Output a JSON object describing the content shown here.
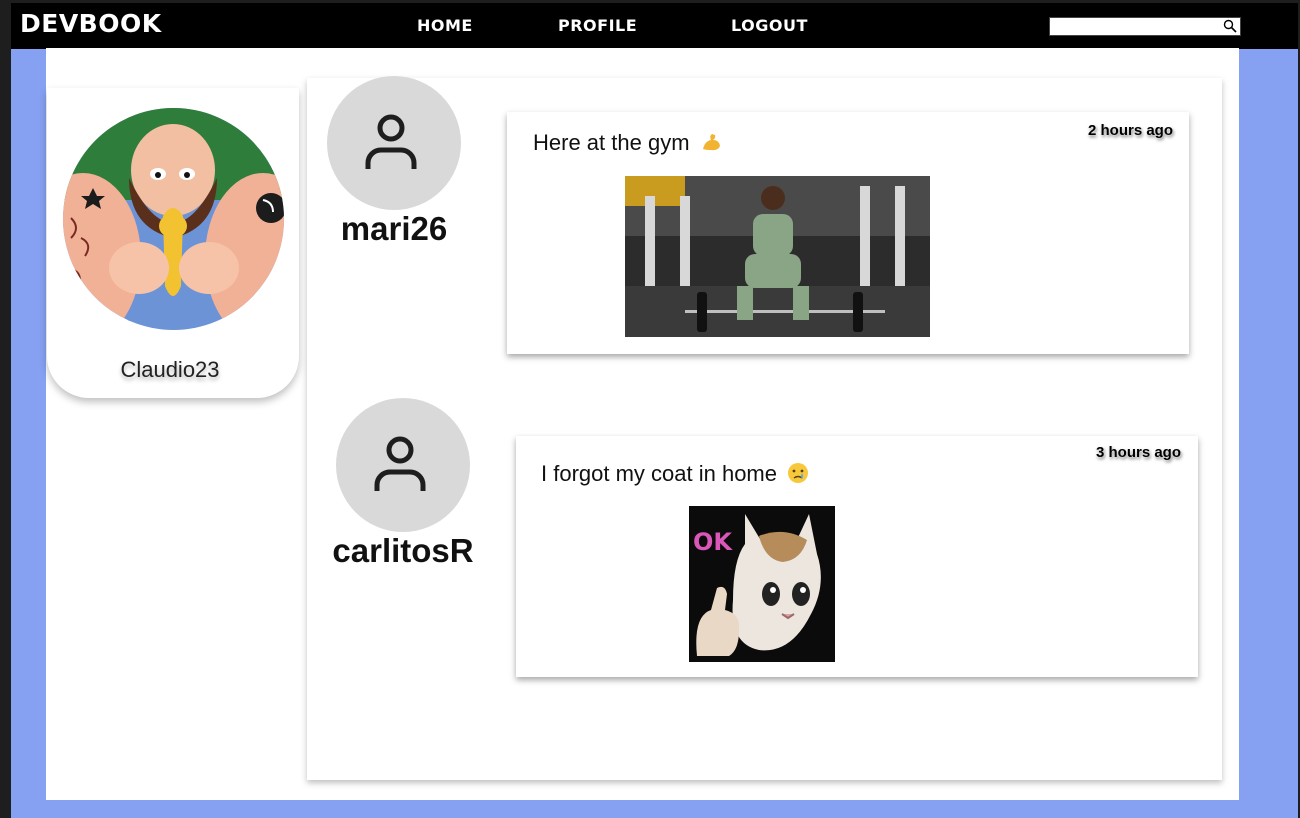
{
  "navbar": {
    "brand": "DEVBOOK",
    "links": [
      "HOME",
      "PROFILE",
      "LOGOUT"
    ],
    "search": {
      "value": "",
      "placeholder": ""
    }
  },
  "profile": {
    "username": "Claudio23"
  },
  "posts": [
    {
      "author": "mari26",
      "text": "Here at the gym",
      "time": "2 hours ago",
      "emoji_icon": "flexed-biceps-icon"
    },
    {
      "author": "carlitosR",
      "text": "I forgot my coat in home",
      "time": "3 hours ago",
      "emoji_icon": "crying-face-icon"
    }
  ],
  "colors": {
    "background": "#86a1f2",
    "navbar": "#000000",
    "avatar_placeholder": "#d9d9d9"
  },
  "images": {
    "post1": "gym-photo",
    "post2": "ok-cat-meme",
    "ok_label": "OK"
  }
}
